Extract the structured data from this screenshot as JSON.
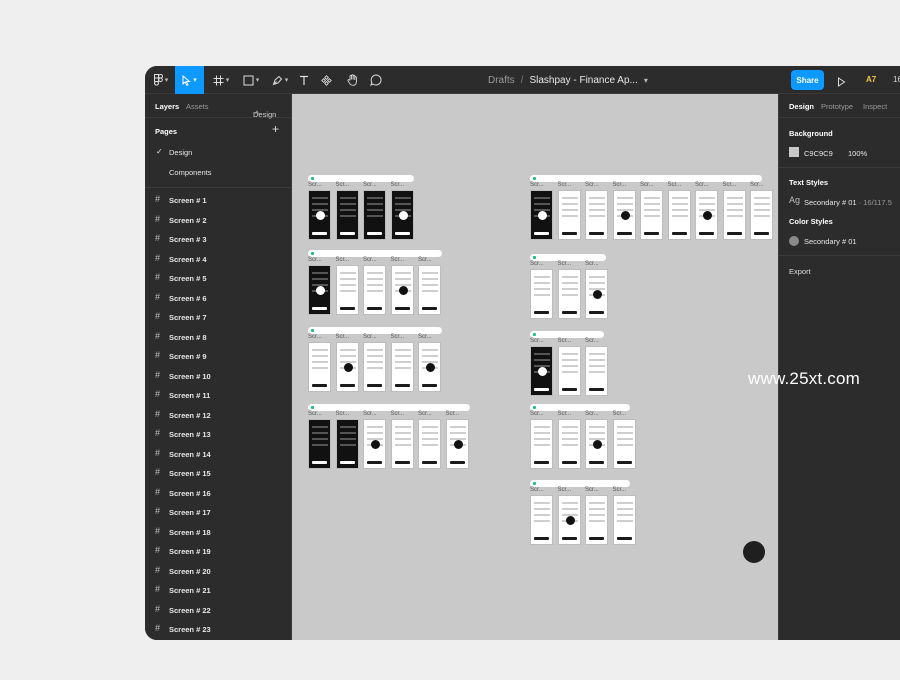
{
  "toolbar": {
    "breadcrumb_parent": "Drafts",
    "file_name": "Slashpay - Finance Ap...",
    "share_label": "Share",
    "zoom_badge": "A7",
    "zoom_value": "16",
    "accent": "#0d99ff"
  },
  "left_panel": {
    "tabs": {
      "layers": "Layers",
      "assets": "Assets",
      "page": "Design"
    },
    "pages_title": "Pages",
    "pages": [
      {
        "label": "Design",
        "selected": true
      },
      {
        "label": "Components",
        "selected": false
      }
    ],
    "layers": [
      "Screen # 1",
      "Screen # 2",
      "Screen # 3",
      "Screen # 4",
      "Screen # 5",
      "Screen # 6",
      "Screen # 7",
      "Screen # 8",
      "Screen # 9",
      "Screen # 10",
      "Screen # 11",
      "Screen # 12",
      "Screen # 13",
      "Screen # 14",
      "Screen # 15",
      "Screen # 16",
      "Screen # 17",
      "Screen # 18",
      "Screen # 19",
      "Screen # 20",
      "Screen # 21",
      "Screen # 22",
      "Screen # 23"
    ]
  },
  "canvas": {
    "background": "#c9c9c9",
    "frame_label": "Scr..."
  },
  "right_panel": {
    "tabs": {
      "design": "Design",
      "prototype": "Prototype",
      "inspect": "Inspect"
    },
    "background_title": "Background",
    "background_hex": "C9C9C9",
    "background_opacity": "100%",
    "text_styles_title": "Text Styles",
    "text_style_icon": "Ag",
    "text_style_name": "Secondary # 01",
    "text_style_meta": "· 16/117.5",
    "color_styles_title": "Color Styles",
    "color_style_name": "Secondary # 01",
    "export_title": "Export"
  },
  "watermark": "www.25xt.com"
}
